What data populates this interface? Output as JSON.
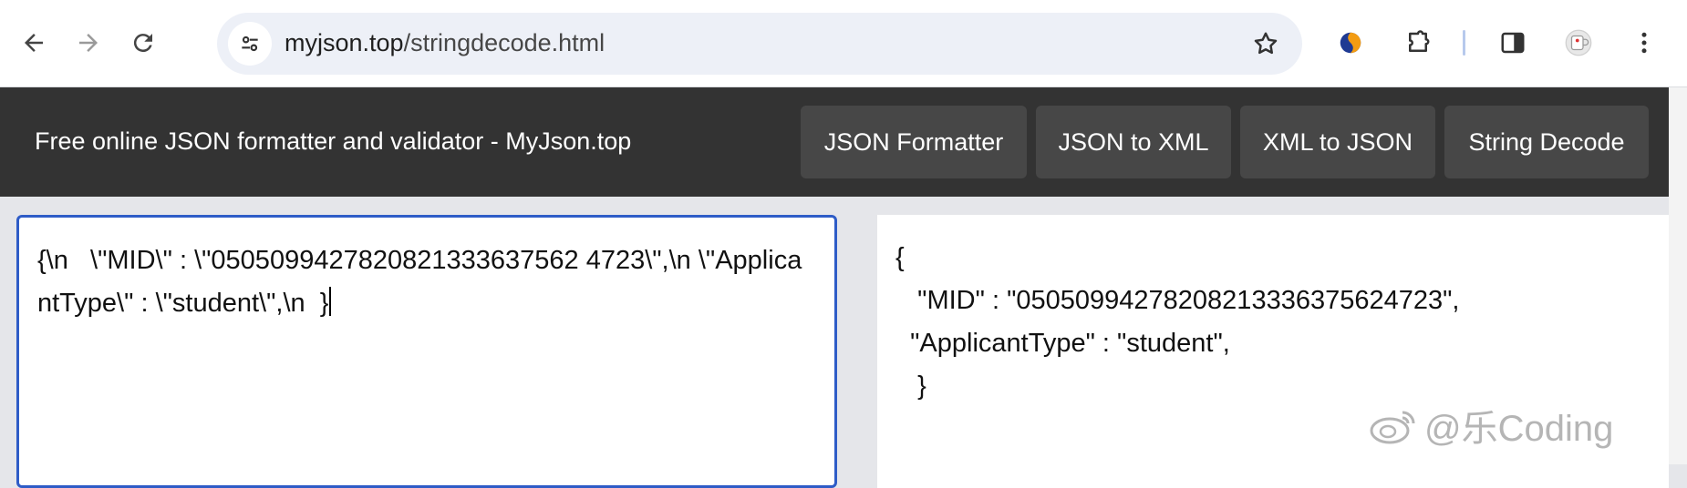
{
  "browser": {
    "url_host": "myjson.top",
    "url_path": "/stringdecode.html",
    "icons": [
      "back-arrow-icon",
      "forward-arrow-icon",
      "reload-icon",
      "site-settings-icon",
      "bookmark-star-icon",
      "extension-icon",
      "puzzle-extensions-icon",
      "side-panel-icon",
      "profile-avatar-icon",
      "more-menu-icon"
    ]
  },
  "header": {
    "title": "Free online JSON formatter and validator - MyJson.top",
    "nav": [
      {
        "label": "JSON Formatter"
      },
      {
        "label": "JSON to XML"
      },
      {
        "label": "XML to JSON"
      },
      {
        "label": "String Decode"
      }
    ]
  },
  "input": {
    "text": "{\\n   \\\"MID\\\" : \\\"0505099427820821333637562 4723\\\",\\n \\\"ApplicantType\\\" : \\\"student\\\",\\n  }"
  },
  "output": {
    "lines": [
      "{",
      "   \"MID\" : \"05050994278208213336375624723\",",
      "  \"ApplicantType\" : \"student\",",
      "   }"
    ]
  },
  "watermark": {
    "text": "@乐Coding"
  },
  "colors": {
    "header_bg": "#333333",
    "nav_button_bg": "#474747",
    "input_border": "#2e5cc7",
    "page_bg": "#e5e6ea"
  }
}
